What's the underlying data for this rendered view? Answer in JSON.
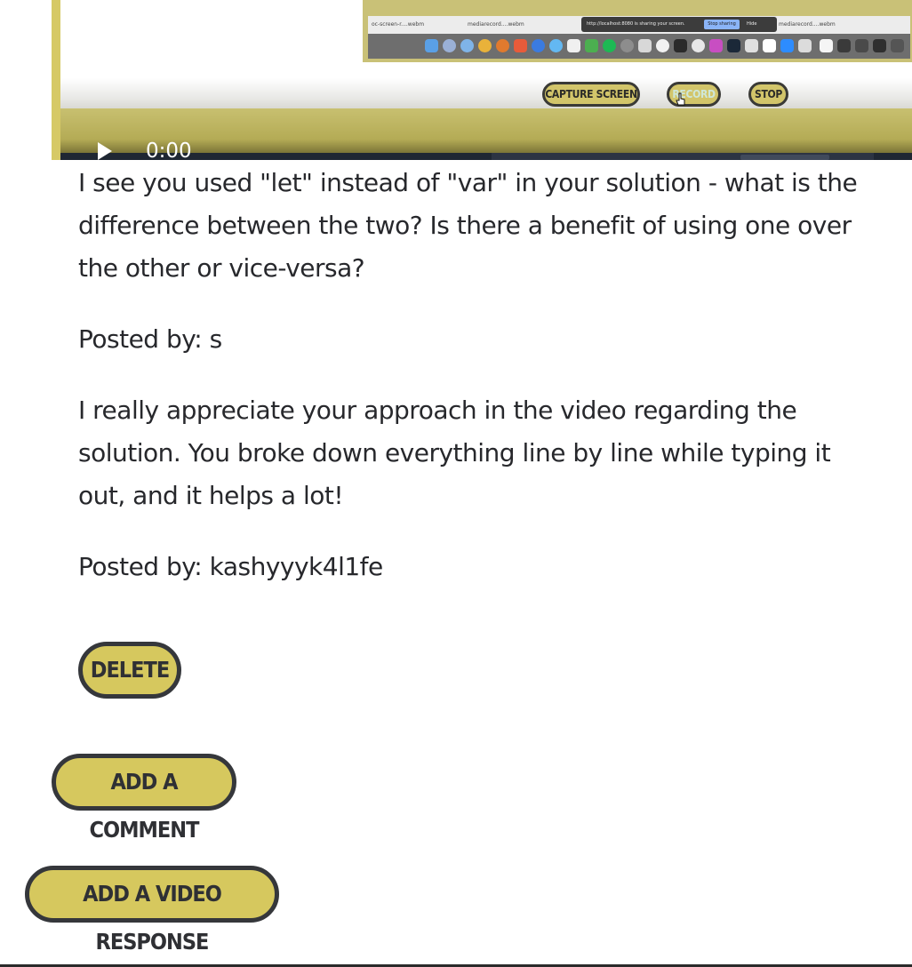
{
  "video": {
    "time": "0:00",
    "controls": {
      "capture_label": "CAPTURE SCREEN",
      "record_label": "RECORD",
      "stop_label": "STOP"
    },
    "screenshot": {
      "tabs": [
        "oc-screen-r....webm",
        "mediarecord....webm",
        "mediarecord....webm"
      ],
      "share_notice": "http://localhost:8080 is sharing your screen.",
      "stop_sharing": "Stop sharing",
      "hide": "Hide"
    }
  },
  "comments": [
    {
      "text": "I see you used \"let\" instead of \"var\" in your solution - what is the difference between the two? Is there a benefit of using one over the other or vice-versa?",
      "author": "Posted by: s"
    },
    {
      "text": "I really appreciate your approach in the video regarding the solution. You broke down everything line by line while typing it out, and it helps a lot!",
      "author": "Posted by: kashyyyk4l1fe"
    }
  ],
  "buttons": {
    "delete": "DELETE",
    "add_comment": "ADD A COMMENT",
    "add_video_response": "ADD A VIDEO RESPONSE"
  },
  "colors": {
    "button_fill": "#d6c85e",
    "button_border": "#35373b",
    "text": "#27282c"
  }
}
